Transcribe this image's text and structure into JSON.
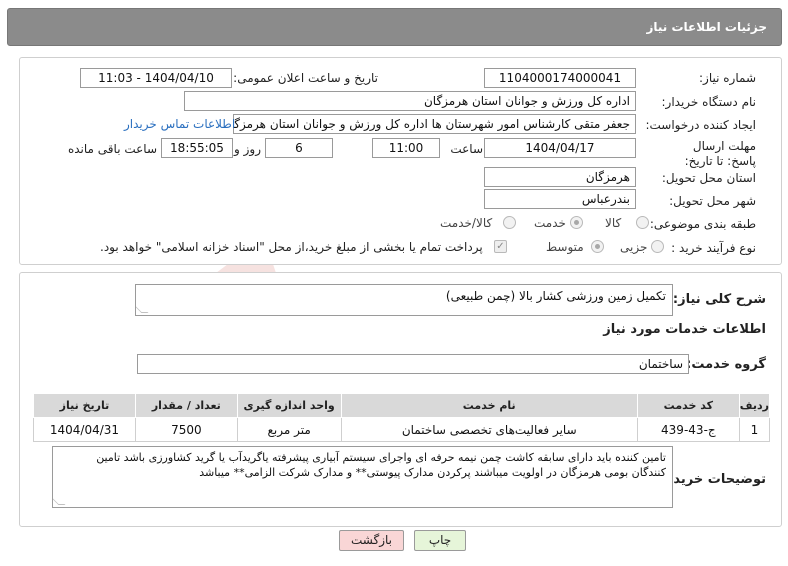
{
  "header": {
    "title": "جزئیات اطلاعات نیاز"
  },
  "need_number": {
    "label": "شماره نیاز:",
    "value": "1104000174000041"
  },
  "announce": {
    "label": "تاریخ و ساعت اعلان عمومی:",
    "value": "1404/04/10 - 11:03"
  },
  "buyer_org": {
    "label": "نام دستگاه خریدار:",
    "value": "اداره کل ورزش و جوانان استان هرمزگان"
  },
  "requester": {
    "label": "ایجاد کننده درخواست:",
    "value": "جعفر متقی کارشناس امور شهرستان ها اداره کل ورزش و جوانان استان هرمزگان",
    "contact_link": "اطلاعات تماس خریدار"
  },
  "deadline": {
    "label": "مهلت ارسال پاسخ: تا تاریخ:",
    "date": "1404/04/17",
    "time_label": "ساعت",
    "time": "11:00",
    "days": "6",
    "days_label": "روز و",
    "remaining": "18:55:05",
    "remaining_label": "ساعت باقی مانده"
  },
  "province": {
    "label": "استان محل تحویل:",
    "value": "هرمزگان"
  },
  "city": {
    "label": "شهر محل تحویل:",
    "value": "بندرعباس"
  },
  "category": {
    "label": "طبقه بندی موضوعی:",
    "options": [
      "کالا",
      "خدمت",
      "کالا/خدمت"
    ],
    "selected": "خدمت"
  },
  "process": {
    "label": "نوع فرآیند خرید :",
    "options": [
      "جزیی",
      "متوسط"
    ],
    "selected": "متوسط",
    "payment_note": "پرداخت تمام یا بخشی از مبلغ خرید،از محل \"اسناد خزانه اسلامی\" خواهد بود."
  },
  "summary": {
    "label": "شرح کلی نیاز:",
    "value": "تکمیل زمین ورزشی کشار بالا (چمن طبیعی)"
  },
  "services": {
    "title": "اطلاعات خدمات مورد نیاز",
    "group_label": "گروه خدمت:",
    "group_value": "ساختمان"
  },
  "table": {
    "headers": [
      "ردیف",
      "کد خدمت",
      "نام خدمت",
      "واحد اندازه گیری",
      "تعداد / مقدار",
      "تاریخ نیاز"
    ],
    "rows": [
      [
        "1",
        "ج-43-439",
        "سایر فعالیت‌های تخصصی ساختمان",
        "متر مربع",
        "7500",
        "1404/04/31"
      ]
    ]
  },
  "notes": {
    "label": "توضیحات خریدار:",
    "value": "تامین کننده باید دارای سابقه کاشت چمن نیمه حرفه ای واجرای سیستم آبیاری پیشرفته یاگریدآب یا گرید کشاورزی باشد تامین کنندگان بومی هرمزگان در اولویت میباشند پرکردن مدارک پیوستی** و مدارک شرکت الزامی** میباشد"
  },
  "buttons": {
    "print": "چاپ",
    "back": "بازگشت"
  },
  "watermark": {
    "text": "AriaTender.net"
  },
  "colors": {
    "header": "#8b8b8b",
    "link": "#2a6fbf",
    "back_button": "#f9d6d6",
    "print_button": "#e6f5d9"
  }
}
